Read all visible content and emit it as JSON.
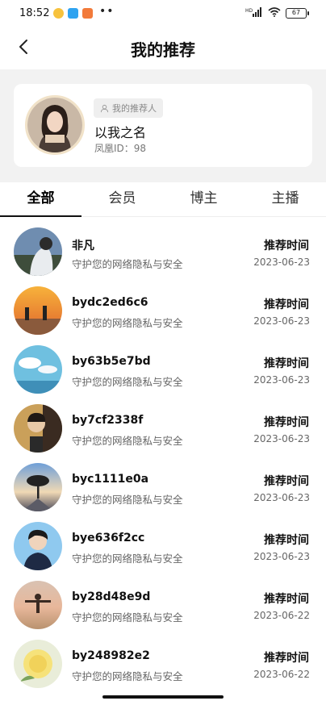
{
  "status_bar": {
    "time": "18:52",
    "battery": "67",
    "signal": "HD",
    "icons": [
      "weibo-icon",
      "app-icon-blue",
      "app-icon-orange",
      "more-dots-icon",
      "signal-icon",
      "wifi-icon",
      "battery-icon"
    ]
  },
  "nav": {
    "title": "我的推荐",
    "back_icon": "chevron-left-icon"
  },
  "referrer": {
    "tag": "我的推荐人",
    "name": "以我之名",
    "id_text": "凤凰ID：98"
  },
  "tabs": [
    {
      "label": "全部",
      "active": true
    },
    {
      "label": "会员",
      "active": false
    },
    {
      "label": "博主",
      "active": false
    },
    {
      "label": "主播",
      "active": false
    }
  ],
  "list": [
    {
      "name": "非凡",
      "sub": "守护您的网络隐私与安全",
      "label": "推荐时间",
      "date": "2023-06-23"
    },
    {
      "name": "bydc2ed6c6",
      "sub": "守护您的网络隐私与安全",
      "label": "推荐时间",
      "date": "2023-06-23"
    },
    {
      "name": "by63b5e7bd",
      "sub": "守护您的网络隐私与安全",
      "label": "推荐时间",
      "date": "2023-06-23"
    },
    {
      "name": "by7cf2338f",
      "sub": "守护您的网络隐私与安全",
      "label": "推荐时间",
      "date": "2023-06-23"
    },
    {
      "name": "byc1111e0a",
      "sub": "守护您的网络隐私与安全",
      "label": "推荐时间",
      "date": "2023-06-23"
    },
    {
      "name": "bye636f2cc",
      "sub": "守护您的网络隐私与安全",
      "label": "推荐时间",
      "date": "2023-06-23"
    },
    {
      "name": "by28d48e9d",
      "sub": "守护您的网络隐私与安全",
      "label": "推荐时间",
      "date": "2023-06-22"
    },
    {
      "name": "by248982e2",
      "sub": "守护您的网络隐私与安全",
      "label": "推荐时间",
      "date": "2023-06-22"
    }
  ]
}
